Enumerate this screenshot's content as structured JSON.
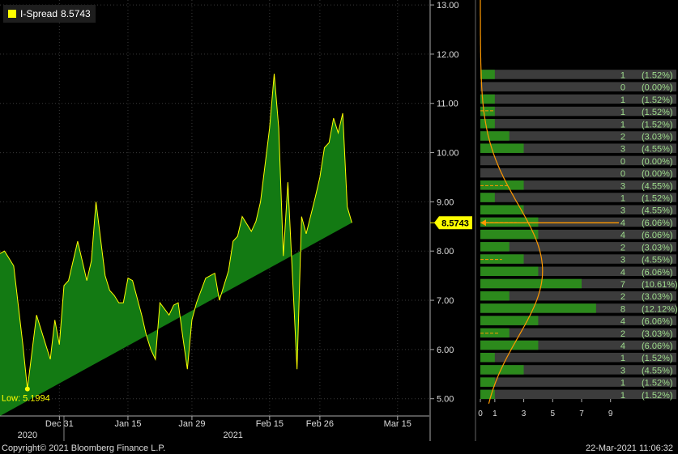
{
  "legend": {
    "name": "I-Spread",
    "value": "8.5743",
    "swatch_color": "#ffff00"
  },
  "low_label": {
    "prefix": "Low:",
    "value": "5.1994"
  },
  "last_label": "8.5743",
  "footer": {
    "copyright": "Copyright© 2021 Bloomberg Finance L.P.",
    "timestamp": "22-Mar-2021 11:06:32"
  },
  "colors": {
    "area_fill": "#137a13",
    "line": "#ffff00",
    "grid": "#3a3a3a",
    "hist_bar": "#2c8a1c",
    "hist_track": "#3c3c3c",
    "curve": "#ff9900",
    "hist_text": "#9edc8c"
  },
  "chart_data": [
    {
      "type": "area",
      "series": [
        {
          "name": "I-Spread"
        }
      ],
      "x_tick_labels": [
        "Dec 31",
        "Jan 15",
        "Jan 29",
        "Feb 15",
        "Feb 26",
        "Mar 15"
      ],
      "x_year_labels": [
        "2020",
        "2021"
      ],
      "y_tick_labels": [
        "5.00",
        "6.00",
        "7.00",
        "8.00",
        "9.00",
        "10.00",
        "11.00",
        "12.00",
        "13.00"
      ],
      "ylim": [
        4.65,
        13.1
      ],
      "x": [
        "2020-12-18",
        "2020-12-19",
        "2020-12-21",
        "2020-12-23",
        "2020-12-24",
        "2020-12-26",
        "2020-12-28",
        "2020-12-29",
        "2020-12-30",
        "2020-12-31",
        "2021-01-01",
        "2021-01-02",
        "2021-01-04",
        "2021-01-06",
        "2021-01-07",
        "2021-01-08",
        "2021-01-10",
        "2021-01-11",
        "2021-01-12",
        "2021-01-13",
        "2021-01-14",
        "2021-01-15",
        "2021-01-16",
        "2021-01-18",
        "2021-01-19",
        "2021-01-20",
        "2021-01-21",
        "2021-01-22",
        "2021-01-24",
        "2021-01-25",
        "2021-01-26",
        "2021-01-27",
        "2021-01-28",
        "2021-01-29",
        "2021-01-30",
        "2021-02-01",
        "2021-02-03",
        "2021-02-04",
        "2021-02-06",
        "2021-02-07",
        "2021-02-08",
        "2021-02-09",
        "2021-02-11",
        "2021-02-12",
        "2021-02-13",
        "2021-02-15",
        "2021-02-16",
        "2021-02-17",
        "2021-02-18",
        "2021-02-19",
        "2021-02-21",
        "2021-02-22",
        "2021-02-23",
        "2021-02-25",
        "2021-02-26",
        "2021-02-27",
        "2021-02-28",
        "2021-03-01",
        "2021-03-02",
        "2021-03-03",
        "2021-03-04",
        "2021-03-05",
        "2021-03-06",
        "2021-03-08",
        "2021-03-09",
        "2021-03-10",
        "2021-03-11",
        "2021-03-12",
        "2021-03-13",
        "2021-03-15",
        "2021-03-16",
        "2021-03-17",
        "2021-03-18",
        "2021-03-19",
        "2021-03-20"
      ],
      "values": [
        7.95,
        8.0,
        7.7,
        6.1,
        5.2,
        6.7,
        6.1,
        5.8,
        6.6,
        6.1,
        7.3,
        7.4,
        8.2,
        7.4,
        7.8,
        9.0,
        7.5,
        7.2,
        7.1,
        6.95,
        6.95,
        7.45,
        7.4,
        6.7,
        6.3,
        6.0,
        5.8,
        6.95,
        6.7,
        6.9,
        6.95,
        6.25,
        5.6,
        6.6,
        6.95,
        7.45,
        7.55,
        7.0,
        7.6,
        8.2,
        8.3,
        8.7,
        8.4,
        8.6,
        9.0,
        10.5,
        11.6,
        10.5,
        7.9,
        9.4,
        5.6,
        8.7,
        8.35,
        9.1,
        9.5,
        10.1,
        10.2,
        10.7,
        10.4,
        10.8,
        8.9,
        8.5743
      ],
      "low": 5.1994,
      "last": 8.5743
    },
    {
      "type": "bar",
      "orientation": "horizontal",
      "description_levels": [
        11.58,
        11.33,
        11.08,
        10.83,
        10.58,
        10.33,
        10.08,
        9.83,
        9.58,
        9.33,
        9.08,
        8.83,
        8.58,
        8.33,
        8.08,
        7.83,
        7.58,
        7.33,
        7.08,
        6.83,
        6.58,
        6.33,
        6.08,
        5.83,
        5.58,
        5.33,
        5.08
      ],
      "counts": [
        1,
        0,
        1,
        1,
        1,
        2,
        3,
        0,
        0,
        3,
        1,
        3,
        4,
        4,
        2,
        3,
        4,
        7,
        2,
        8,
        4,
        2,
        4,
        1,
        3,
        1,
        1
      ],
      "percents": [
        "(1.52%)",
        "(0.00%)",
        "(1.52%)",
        "(1.52%)",
        "(1.52%)",
        "(3.03%)",
        "(4.55%)",
        "(0.00%)",
        "(0.00%)",
        "(4.55%)",
        "(1.52%)",
        "(4.55%)",
        "(6.06%)",
        "(6.06%)",
        "(3.03%)",
        "(4.55%)",
        "(6.06%)",
        "(10.61%)",
        "(3.03%)",
        "(12.12%)",
        "(6.06%)",
        "(3.03%)",
        "(6.06%)",
        "(1.52%)",
        "(4.55%)",
        "(1.52%)",
        "(1.52%)"
      ],
      "x_tick_labels": [
        "0",
        "1",
        "3",
        "5",
        "7",
        "9"
      ],
      "x_tick_values": [
        0,
        1,
        3,
        5,
        7,
        9
      ],
      "xlim": [
        0,
        11.2
      ]
    }
  ]
}
